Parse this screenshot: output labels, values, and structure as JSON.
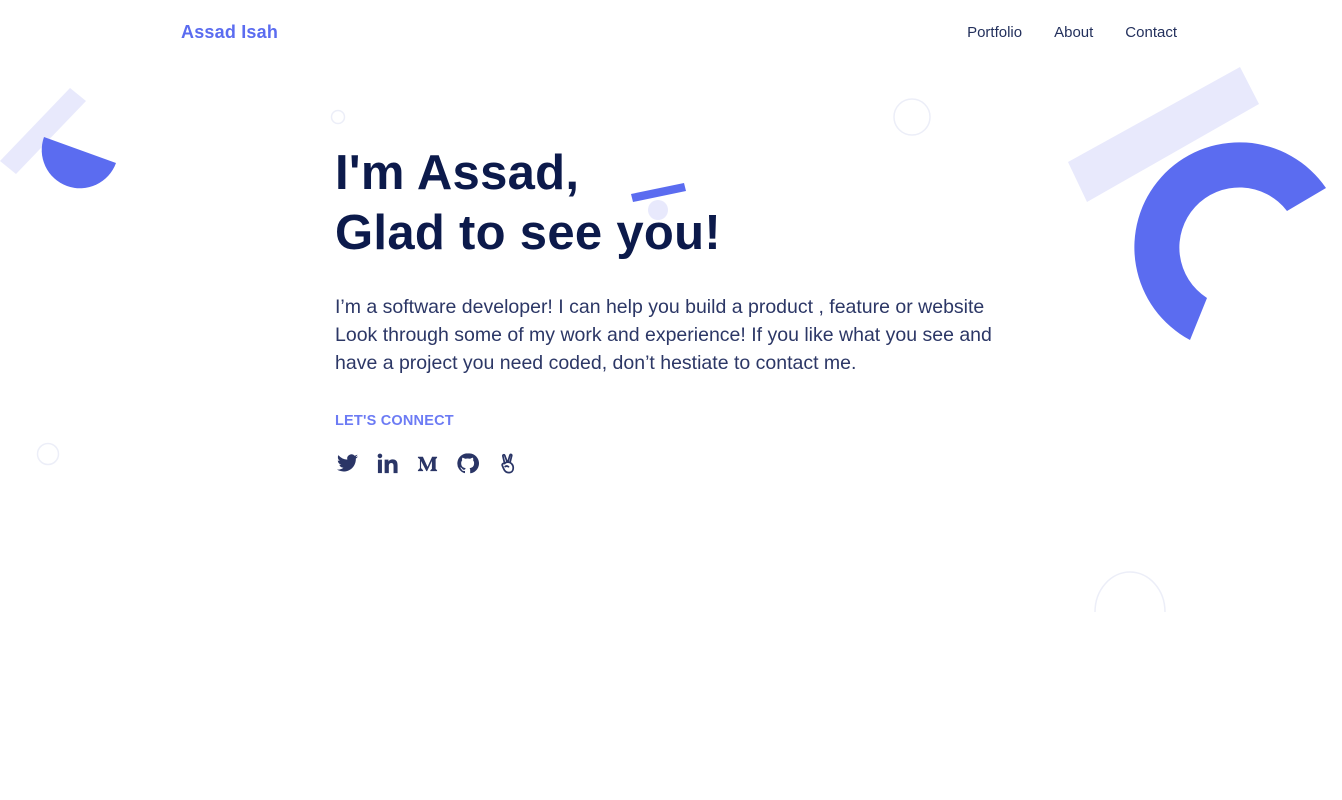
{
  "brand": "Assad Isah",
  "nav": {
    "portfolio": "Portfolio",
    "about": "About",
    "contact": "Contact"
  },
  "hero": {
    "line1": "I'm Assad,",
    "line2": "Glad to see you!",
    "intro": "I’m a software developer! I can help you build a product , feature or website Look through some of my work and experience! If you like what you see and have a project you need coded, don’t hestiate to contact me.",
    "connect_label": "LET'S CONNECT"
  },
  "socials": [
    {
      "icon": "twitter-icon"
    },
    {
      "icon": "linkedin-icon"
    },
    {
      "icon": "medium-icon"
    },
    {
      "icon": "github-icon"
    },
    {
      "icon": "angellist-icon"
    }
  ],
  "colors": {
    "accent": "#5b6cf0",
    "accent_light": "#e8e9fc",
    "heading": "#0c1a4b",
    "body": "#2c3766"
  }
}
